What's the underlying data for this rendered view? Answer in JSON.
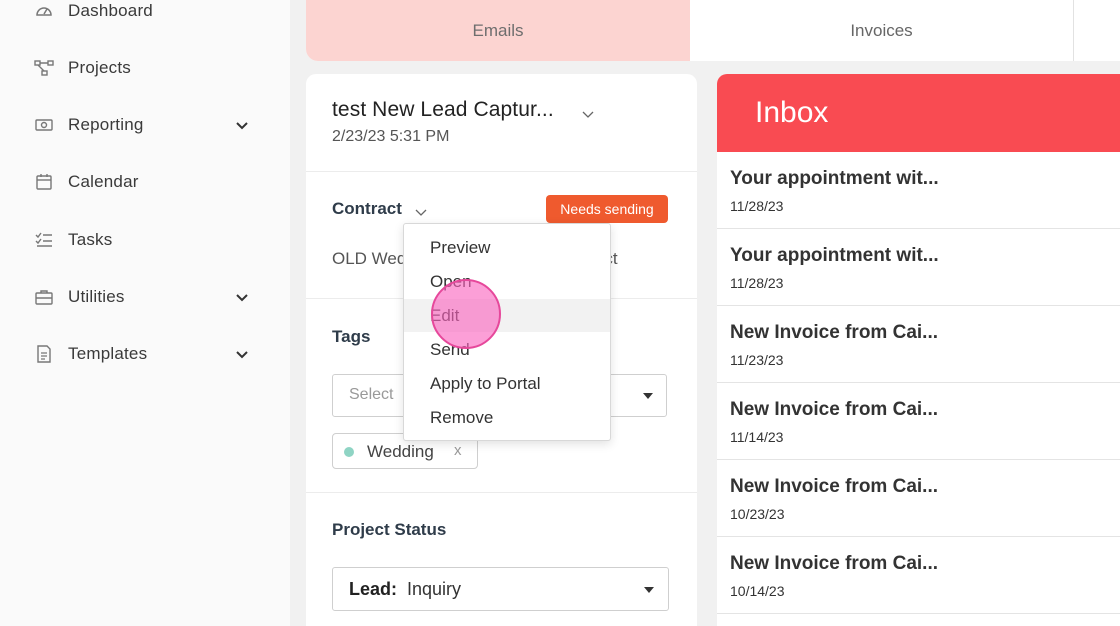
{
  "sidebar": {
    "items": [
      {
        "label": "Dashboard",
        "icon": "dashboard-icon",
        "expandable": false
      },
      {
        "label": "Projects",
        "icon": "projects-icon",
        "expandable": false
      },
      {
        "label": "Reporting",
        "icon": "reporting-icon",
        "expandable": true
      },
      {
        "label": "Calendar",
        "icon": "calendar-icon",
        "expandable": false
      },
      {
        "label": "Tasks",
        "icon": "tasks-icon",
        "expandable": false
      },
      {
        "label": "Utilities",
        "icon": "utilities-icon",
        "expandable": true
      },
      {
        "label": "Templates",
        "icon": "templates-icon",
        "expandable": true
      }
    ]
  },
  "tabs": [
    {
      "label": "Emails",
      "active": true
    },
    {
      "label": "Invoices",
      "active": false
    }
  ],
  "project": {
    "title": "test New Lead Captur...",
    "date": "2/23/23 5:31 PM",
    "contract": {
      "label": "Contract",
      "badge": "Needs sending",
      "name": "OLD Wed",
      "name_tail": "ct"
    },
    "tags": {
      "label": "Tags",
      "placeholder": "Select",
      "chips": [
        {
          "label": "Wedding",
          "remove": "x"
        }
      ]
    },
    "status": {
      "label": "Project Status",
      "key": "Lead:",
      "value": "Inquiry"
    }
  },
  "context_menu": {
    "items": [
      "Preview",
      "Open",
      "Edit",
      "Send",
      "Apply to Portal",
      "Remove"
    ],
    "hovered": "Edit"
  },
  "inbox": {
    "title": "Inbox",
    "messages": [
      {
        "subject": "Your appointment wit...",
        "date": "11/28/23"
      },
      {
        "subject": "Your appointment wit...",
        "date": "11/28/23"
      },
      {
        "subject": "New Invoice from Cai...",
        "date": "11/23/23"
      },
      {
        "subject": "New Invoice from Cai...",
        "date": "11/14/23"
      },
      {
        "subject": "New Invoice from Cai...",
        "date": "10/23/23"
      },
      {
        "subject": "New Invoice from Cai...",
        "date": "10/14/23"
      }
    ]
  },
  "colors": {
    "accent_red": "#f94b52",
    "badge_orange": "#ef5a2e",
    "active_tab": "#fcd4d1",
    "click_highlight": "#e6489b",
    "tag_dot": "#8fd4c4"
  }
}
